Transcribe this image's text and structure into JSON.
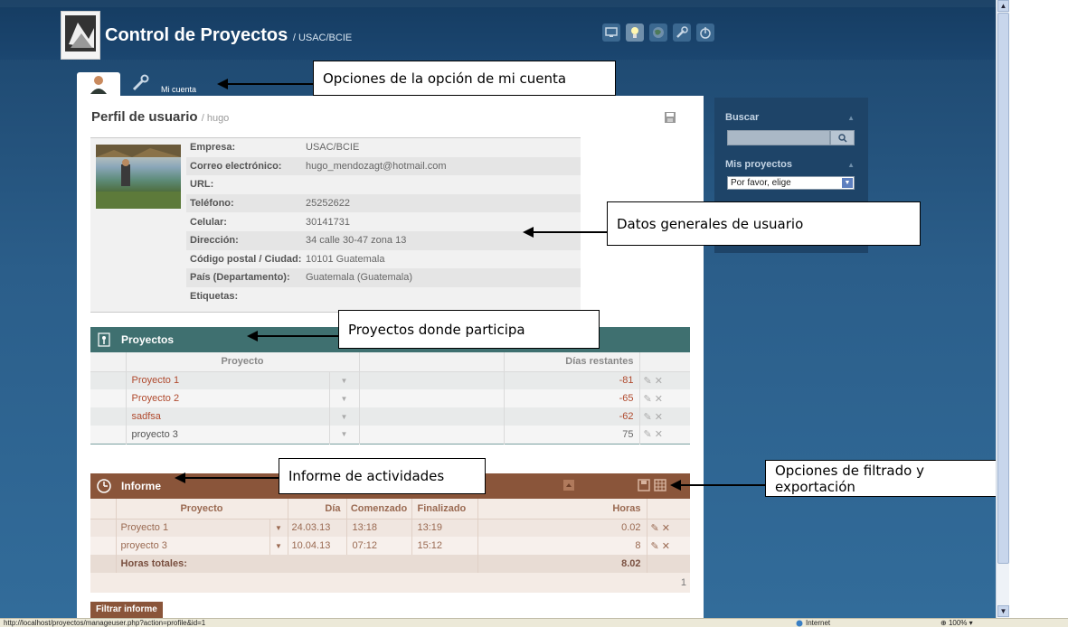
{
  "app": {
    "title": "Control de Proyectos",
    "subtitle": "/ USAC/BCIE",
    "top_icons": [
      "monitor-icon",
      "lightbulb-icon",
      "globe-icon",
      "wrench-icon",
      "power-icon"
    ]
  },
  "tabs": {
    "account_label": "Mi cuenta"
  },
  "profile": {
    "title": "Perfil de usuario",
    "username": "/ hugo",
    "fields": [
      {
        "label": "Empresa:",
        "value": "USAC/BCIE"
      },
      {
        "label": "Correo electrónico:",
        "value": "hugo_mendozagt@hotmail.com"
      },
      {
        "label": "URL:",
        "value": ""
      },
      {
        "label": "Teléfono:",
        "value": "25252622"
      },
      {
        "label": "Celular:",
        "value": "30141731"
      },
      {
        "label": "Dirección:",
        "value": "34 calle 30-47 zona 13"
      },
      {
        "label": "Código postal / Ciudad:",
        "value": "10101 Guatemala"
      },
      {
        "label": "País (Departamento):",
        "value": "Guatemala (Guatemala)"
      },
      {
        "label": "Etiquetas:",
        "value": ""
      }
    ]
  },
  "projects": {
    "title": "Proyectos",
    "columns": {
      "project": "Proyecto",
      "days": "Días restantes"
    },
    "rows": [
      {
        "name": "Proyecto 1",
        "days": "-81"
      },
      {
        "name": "Proyecto 2",
        "days": "-65"
      },
      {
        "name": "sadfsa",
        "days": "-62"
      },
      {
        "name": "proyecto 3",
        "days": "75"
      }
    ]
  },
  "report": {
    "title": "Informe",
    "columns": {
      "project": "Proyecto",
      "day": "Día",
      "started": "Comenzado",
      "finished": "Finalizado",
      "hours": "Horas"
    },
    "rows": [
      {
        "project": "Proyecto 1",
        "day": "24.03.13",
        "started": "13:18",
        "finished": "13:19",
        "hours": "0.02"
      },
      {
        "project": "proyecto 3",
        "day": "10.04.13",
        "started": "07:12",
        "finished": "15:12",
        "hours": "8"
      }
    ],
    "total_label": "Horas totales:",
    "total_hours": "8.02",
    "page": "1",
    "filter_button": "Filtrar informe"
  },
  "sidebar": {
    "search_title": "Buscar",
    "search_value": "",
    "projects_title": "Mis proyectos",
    "projects_selected": "Por favor, elige"
  },
  "annotations": {
    "account_options": "Opciones de la opción de mi cuenta",
    "user_data": "Datos generales de usuario",
    "projects": "Proyectos donde  participa",
    "activity_report": "Informe de actividades",
    "filter_export": "Opciones de filtrado y exportación"
  },
  "statusbar": {
    "url": "http://localhost/proyectos/manageuser.php?action=profile&id=1",
    "zone": "Internet",
    "zoom": "100%"
  }
}
